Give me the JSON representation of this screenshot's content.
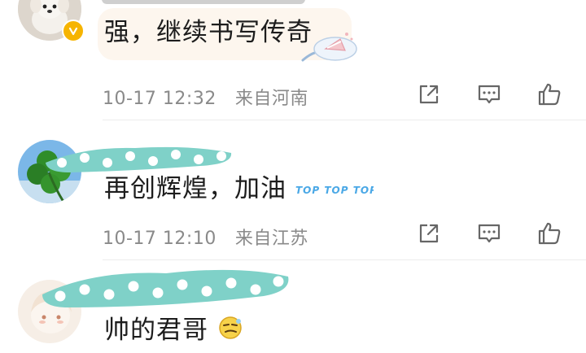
{
  "comments": [
    {
      "text": "强，继续书写传奇",
      "time": "10-17 12:32",
      "location": "来自河南"
    },
    {
      "text": "再创辉煌，加油",
      "sticker_text": "TOP TOP TOP",
      "time": "10-17 12:10",
      "location": "来自江苏"
    },
    {
      "text": "帅的君哥"
    }
  ],
  "icons": {
    "share": "share-icon",
    "comment": "comment-icon",
    "like": "thumbs-up-icon"
  },
  "colors": {
    "mask_teal": "#7fd1c8",
    "badge": "#f6b400",
    "meta_text": "#8a8a8a"
  }
}
